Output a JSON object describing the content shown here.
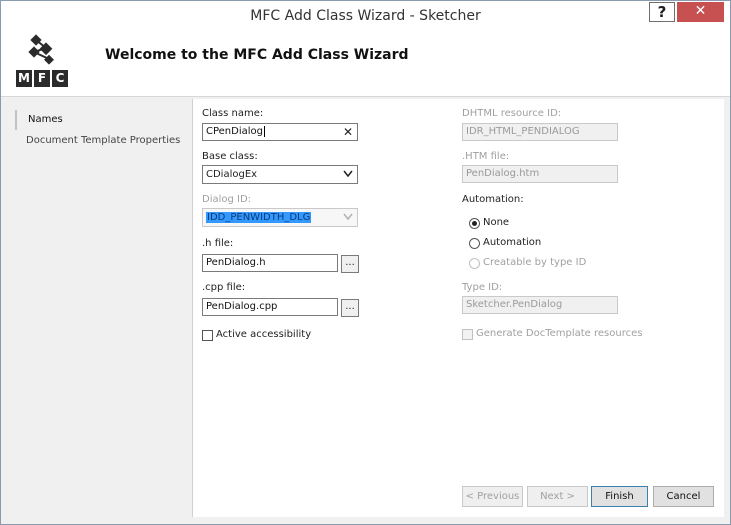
{
  "window": {
    "title": "MFC Add Class Wizard - Sketcher",
    "help_label": "?",
    "close_label": "✕"
  },
  "header": {
    "logo_letters": [
      "M",
      "F",
      "C"
    ],
    "title": "Welcome to the MFC Add Class Wizard"
  },
  "sidebar": {
    "items": [
      {
        "label": "Names"
      },
      {
        "label": "Document Template Properties"
      }
    ]
  },
  "form": {
    "class_name": {
      "label": "Class name:",
      "value": "CPenDialog"
    },
    "base_class": {
      "label": "Base class:",
      "value": "CDialogEx"
    },
    "dialog_id": {
      "label": "Dialog ID:",
      "value": "IDD_PENWIDTH_DLG"
    },
    "h_file": {
      "label": ".h file:",
      "value": "PenDialog.h",
      "browse": "..."
    },
    "cpp_file": {
      "label": ".cpp file:",
      "value": "PenDialog.cpp",
      "browse": "..."
    },
    "active_accessibility": {
      "label": "Active accessibility",
      "checked": false
    },
    "dhtml_resource_id": {
      "label": "DHTML resource ID:",
      "value": "IDR_HTML_PENDIALOG"
    },
    "htm_file": {
      "label": ".HTM file:",
      "value": "PenDialog.htm"
    },
    "automation": {
      "label": "Automation:",
      "options": [
        {
          "label": "None",
          "selected": true,
          "enabled": true
        },
        {
          "label": "Automation",
          "selected": false,
          "enabled": true
        },
        {
          "label": "Creatable by type ID",
          "selected": false,
          "enabled": false
        }
      ]
    },
    "type_id": {
      "label": "Type ID:",
      "value": "Sketcher.PenDialog"
    },
    "generate_doctemplate": {
      "label": "Generate DocTemplate resources",
      "checked": false
    }
  },
  "buttons": {
    "previous": "< Previous",
    "next": "Next >",
    "finish": "Finish",
    "cancel": "Cancel"
  }
}
